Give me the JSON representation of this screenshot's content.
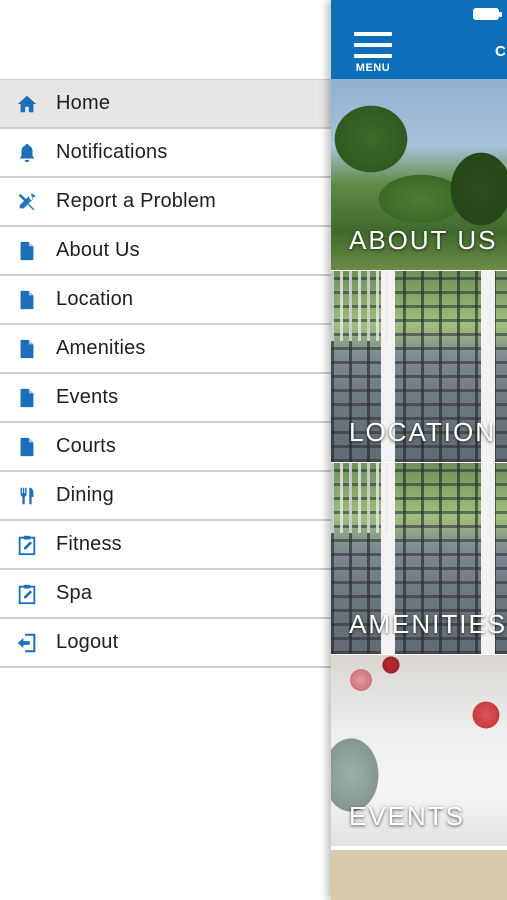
{
  "drawer": {
    "items": [
      {
        "label": "Home",
        "icon": "home-icon",
        "active": true
      },
      {
        "label": "Notifications",
        "icon": "bell-icon",
        "active": false
      },
      {
        "label": "Report a Problem",
        "icon": "tools-icon",
        "active": false
      },
      {
        "label": "About Us",
        "icon": "document-icon",
        "active": false
      },
      {
        "label": "Location",
        "icon": "document-icon",
        "active": false
      },
      {
        "label": "Amenities",
        "icon": "document-icon",
        "active": false
      },
      {
        "label": "Events",
        "icon": "document-icon",
        "active": false
      },
      {
        "label": "Courts",
        "icon": "document-icon",
        "active": false
      },
      {
        "label": "Dining",
        "icon": "utensils-icon",
        "active": false
      },
      {
        "label": "Fitness",
        "icon": "clipboard-icon",
        "active": false
      },
      {
        "label": "Spa",
        "icon": "clipboard-icon",
        "active": false
      },
      {
        "label": "Logout",
        "icon": "logout-icon",
        "active": false
      }
    ]
  },
  "app_bar": {
    "menu_label": "MENU",
    "title_partial": "C"
  },
  "tiles": [
    {
      "label": "ABOUT US"
    },
    {
      "label": "LOCATION"
    },
    {
      "label": "AMENITIES"
    },
    {
      "label": "EVENTS"
    }
  ],
  "colors": {
    "brand_blue": "#0d6fba",
    "icon_blue": "#1a6fb8",
    "active_row": "#e6e6e6",
    "divider": "#cfcfcf"
  }
}
